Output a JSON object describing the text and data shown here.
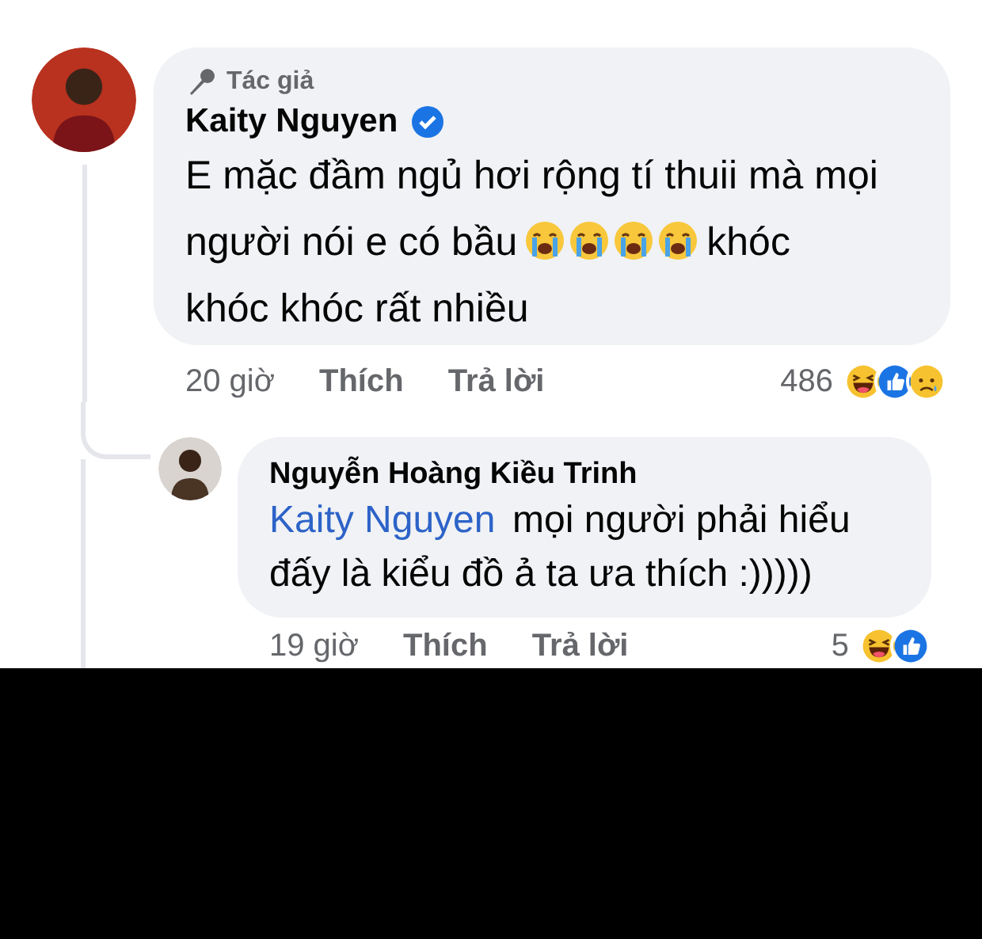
{
  "comments": [
    {
      "author_badge": "Tác giả",
      "author": "Kaity Nguyen",
      "verified": true,
      "body": [
        {
          "kind": "line",
          "text": "E mặc đầm ngủ hơi rộng tí thuii mà mọi"
        },
        {
          "kind": "text",
          "text": "người nói e có bầu"
        },
        {
          "kind": "emoji"
        },
        {
          "kind": "emoji"
        },
        {
          "kind": "emoji"
        },
        {
          "kind": "emoji"
        },
        {
          "kind": "text",
          "text": "khóc"
        },
        {
          "kind": "line",
          "text": "khóc khóc rất nhiều"
        }
      ],
      "time": "20 giờ",
      "like": "Thích",
      "reply": "Trả lời",
      "reaction_count": "486",
      "reactions": [
        {
          "kind": "haha"
        },
        {
          "kind": "like"
        },
        {
          "kind": "sad"
        }
      ],
      "replies": [
        {
          "author": "Nguyễn Hoàng Kiều Trinh",
          "body": [
            {
              "kind": "mention",
              "text": "Kaity Nguyen"
            },
            {
              "kind": "text",
              "text": "mọi người phải hiểu"
            },
            {
              "kind": "line",
              "text": "đấy là kiểu đồ ả ta ưa thích :)))))"
            }
          ],
          "time": "19 giờ",
          "like": "Thích",
          "reply": "Trả lời",
          "reaction_count": "5",
          "reactions": [
            {
              "kind": "haha"
            },
            {
              "kind": "like"
            }
          ]
        }
      ]
    }
  ]
}
